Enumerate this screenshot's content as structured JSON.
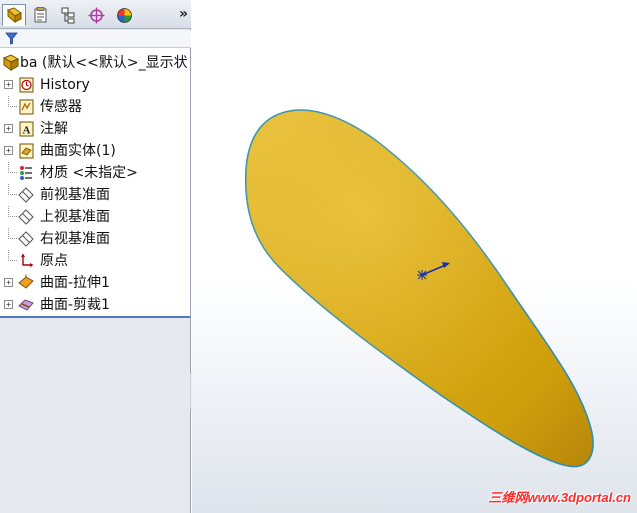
{
  "tabs": [
    {
      "name": "feature-manager-tab",
      "icon": "feature-tree-icon",
      "active": true
    },
    {
      "name": "property-manager-tab",
      "icon": "property-sheet-icon",
      "active": false
    },
    {
      "name": "configuration-manager-tab",
      "icon": "configuration-icon",
      "active": false
    },
    {
      "name": "dimxpert-manager-tab",
      "icon": "dimxpert-crosshair-icon",
      "active": false
    },
    {
      "name": "display-manager-tab",
      "icon": "appearance-sphere-icon",
      "active": false
    }
  ],
  "more_tabs_label": "»",
  "tree": {
    "root_label": "ba  (默认<<默认>_显示状",
    "items": [
      {
        "label": "History",
        "icon": "history-icon",
        "expandable": true
      },
      {
        "label": "传感器",
        "icon": "sensor-icon",
        "expandable": false
      },
      {
        "label": "注解",
        "icon": "annotation-icon",
        "expandable": true
      },
      {
        "label": "曲面实体(1)",
        "icon": "surface-bodies-icon",
        "expandable": true
      },
      {
        "label": "材质 <未指定>",
        "icon": "material-icon",
        "expandable": false
      },
      {
        "label": "前视基准面",
        "icon": "plane-icon",
        "expandable": false
      },
      {
        "label": "上视基准面",
        "icon": "plane-icon",
        "expandable": false
      },
      {
        "label": "右视基准面",
        "icon": "plane-icon",
        "expandable": false
      },
      {
        "label": "原点",
        "icon": "origin-icon",
        "expandable": false
      },
      {
        "label": "曲面-拉伸1",
        "icon": "surface-extrude-icon",
        "expandable": true
      },
      {
        "label": "曲面-剪裁1",
        "icon": "surface-trim-icon",
        "expandable": true
      }
    ]
  },
  "colors": {
    "surface_fill": "#d8aa18",
    "surface_edge": "#2f8fb0",
    "selection_bar": "#4f79c0",
    "watermark": "#ff2a2a"
  },
  "watermark": "三维网www.3dportal.cn"
}
